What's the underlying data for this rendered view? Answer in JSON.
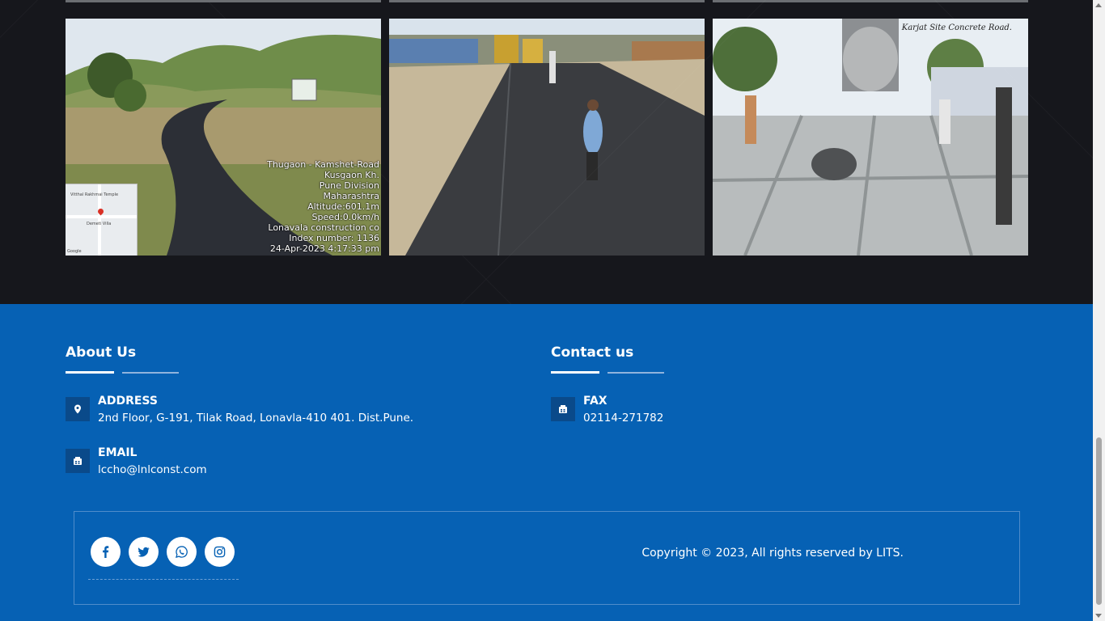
{
  "gallery": {
    "photo1": {
      "caption_lines": [
        "Thugaon - Kamshet-Road",
        "Kusgaon Kh.",
        "Pune Division",
        "Maharashtra",
        "Altitude:601.1m",
        "Speed:0.0km/h",
        "Lonavala construction co",
        "Index number: 1136",
        "24-Apr-2023 4:17:33 pm"
      ],
      "map_labels": [
        "Vitthal Rakhmai Temple",
        "Demeti Villa",
        "Google"
      ]
    },
    "photo3": {
      "overlay_title": "Karjat Site Concrete Road."
    }
  },
  "footer": {
    "about": {
      "title": "About Us",
      "address_label": "ADDRESS",
      "address_value": "2nd Floor, G-191, Tilak Road, Lonavla-410 401. Dist.Pune.",
      "email_label": "EMAIL",
      "email_value": "lccho@lnlconst.com"
    },
    "contact": {
      "title": "Contact us",
      "fax_label": "FAX",
      "fax_value": "02114-271782"
    },
    "socials": [
      {
        "icon": "facebook-icon"
      },
      {
        "icon": "twitter-icon"
      },
      {
        "icon": "whatsapp-icon"
      },
      {
        "icon": "instagram-icon"
      }
    ],
    "copyright": "Copyright © 2023, All rights reserved by LITS."
  },
  "colors": {
    "footer_bg": "#0661b4",
    "gallery_bg": "#16171c",
    "icon_box": "#0a4a8a",
    "social_icon": "#0661b4"
  }
}
